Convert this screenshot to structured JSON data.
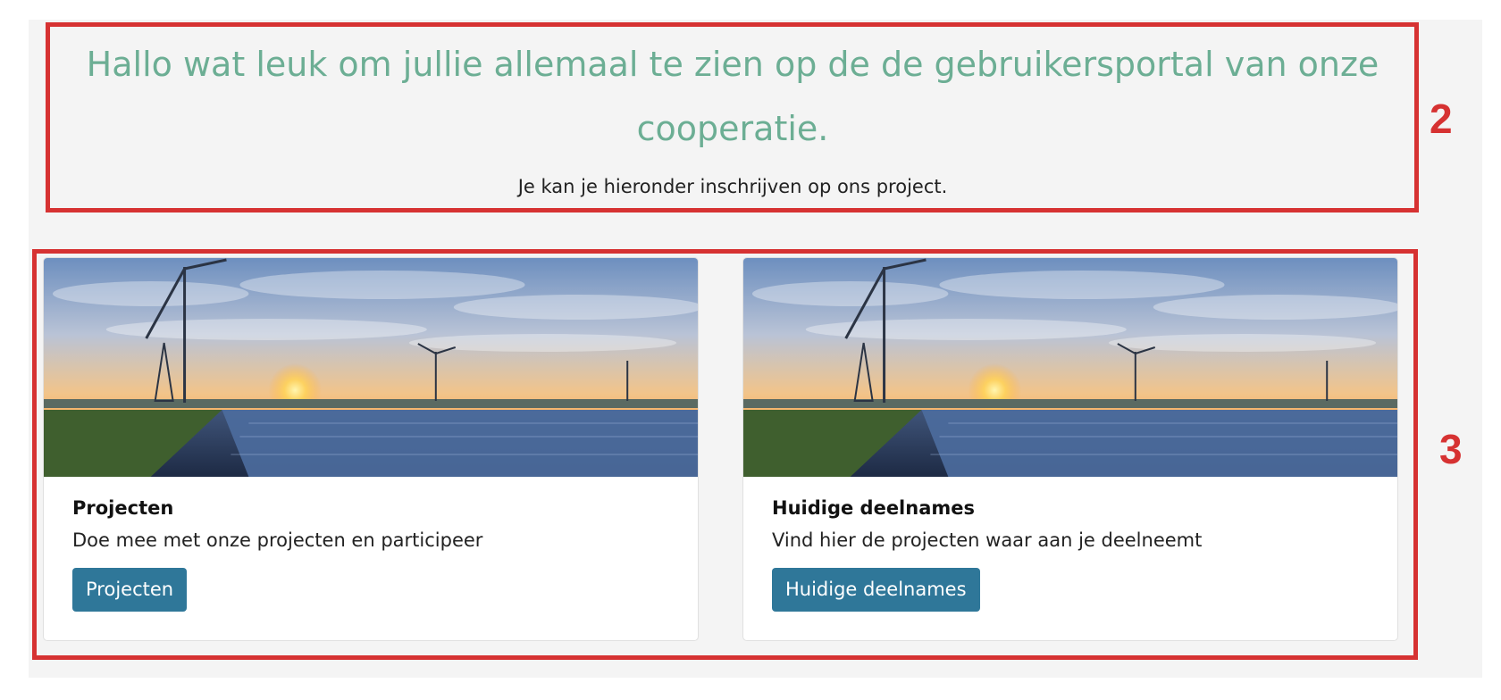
{
  "hero": {
    "title": "Hallo wat leuk om jullie allemaal te zien op de de gebruikersportal van onze cooperatie.",
    "subtitle": "Je kan je hieronder inschrijven op ons project."
  },
  "cards": [
    {
      "title": "Projecten",
      "text": "Doe mee met onze projecten en participeer",
      "button_label": "Projecten",
      "image_icon": "wind-solar-sunset-image"
    },
    {
      "title": "Huidige deelnames",
      "text": "Vind hier de projecten waar aan je deelneemt",
      "button_label": "Huidige deelnames",
      "image_icon": "wind-solar-sunset-image"
    }
  ],
  "annotations": {
    "box_2_label": "2",
    "box_3_label": "3"
  },
  "colors": {
    "title": "#6cae94",
    "button": "#2f7799",
    "annotation": "#d63232"
  }
}
